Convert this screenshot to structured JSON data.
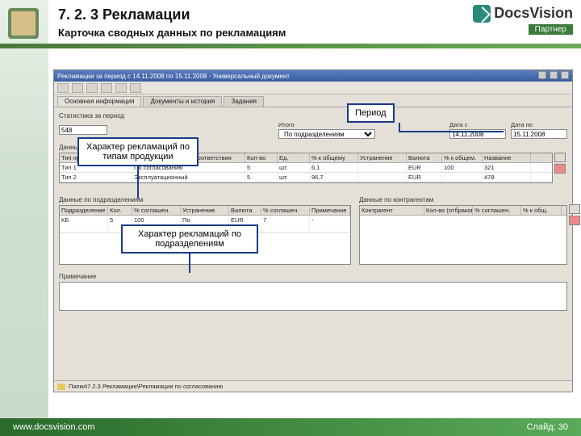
{
  "slide": {
    "heading_num": "7. 2. 3  Рекламации",
    "subtitle": "Карточка сводных данных по рекламациям",
    "footer_url": "www.docsvision.com",
    "footer_slide": "Слайд: 30",
    "dv_brand": "DocsVision",
    "dv_partner": "Партнер"
  },
  "window": {
    "title": "Рекламации за период с 14.11.2008 по 15.11.2008 - Универсальный документ",
    "tabs": [
      "Основная информация",
      "Документы и история",
      "Задания"
    ],
    "stat_label": "Статистика за период",
    "stat_num": "548",
    "period_group": "Период",
    "date_from_label": "Дата с",
    "date_from": "14.11.2008",
    "date_to_label": "Дата по",
    "date_to": "15.11.2008",
    "mid_label": "Итого",
    "mid_dropdown": "По подразделениям",
    "data_label": "Данные",
    "grid1_cols": [
      "Тип продукции",
      "Характер дефекта/несоответствия",
      "Кол-во",
      "Ед.",
      "% к общему",
      "Устранение",
      "Валюта",
      "% к общем.",
      "Название"
    ],
    "grid1_rows": [
      [
        "Тип 1",
        "По согласованию",
        "5",
        "шт.",
        "6,1",
        "",
        "EUR",
        "100",
        "321"
      ],
      [
        "Тип 2",
        "Эксплуатационный",
        "5",
        "шт.",
        "96,7",
        "",
        "EUR",
        "",
        "478"
      ]
    ],
    "grid2_label_l": "Данные по подразделениям",
    "grid2_label_r": "Данные по контрагентам",
    "grid2_cols_l": [
      "Подразделение",
      "Кол.",
      "% соглашен.",
      "Устранение",
      "Валюта",
      "% соглашен.",
      "Примечание"
    ],
    "grid2_rows_l": [
      [
        "КБ",
        "5",
        "100",
        "По согласованию",
        "EUR",
        "7",
        "-"
      ]
    ],
    "grid2_cols_r": [
      "Контрагент",
      "Кол-во (отбракован)",
      "% соглашен.",
      "% к общ."
    ],
    "note_label": "Примечание",
    "status": "Папки\\7.2.3 Рекламации\\Рекламации по согласованию"
  },
  "callouts": {
    "period": "Период",
    "by_type": "Характер рекламаций по типам продукции",
    "by_dept": "Характер рекламаций по подразделениям"
  }
}
